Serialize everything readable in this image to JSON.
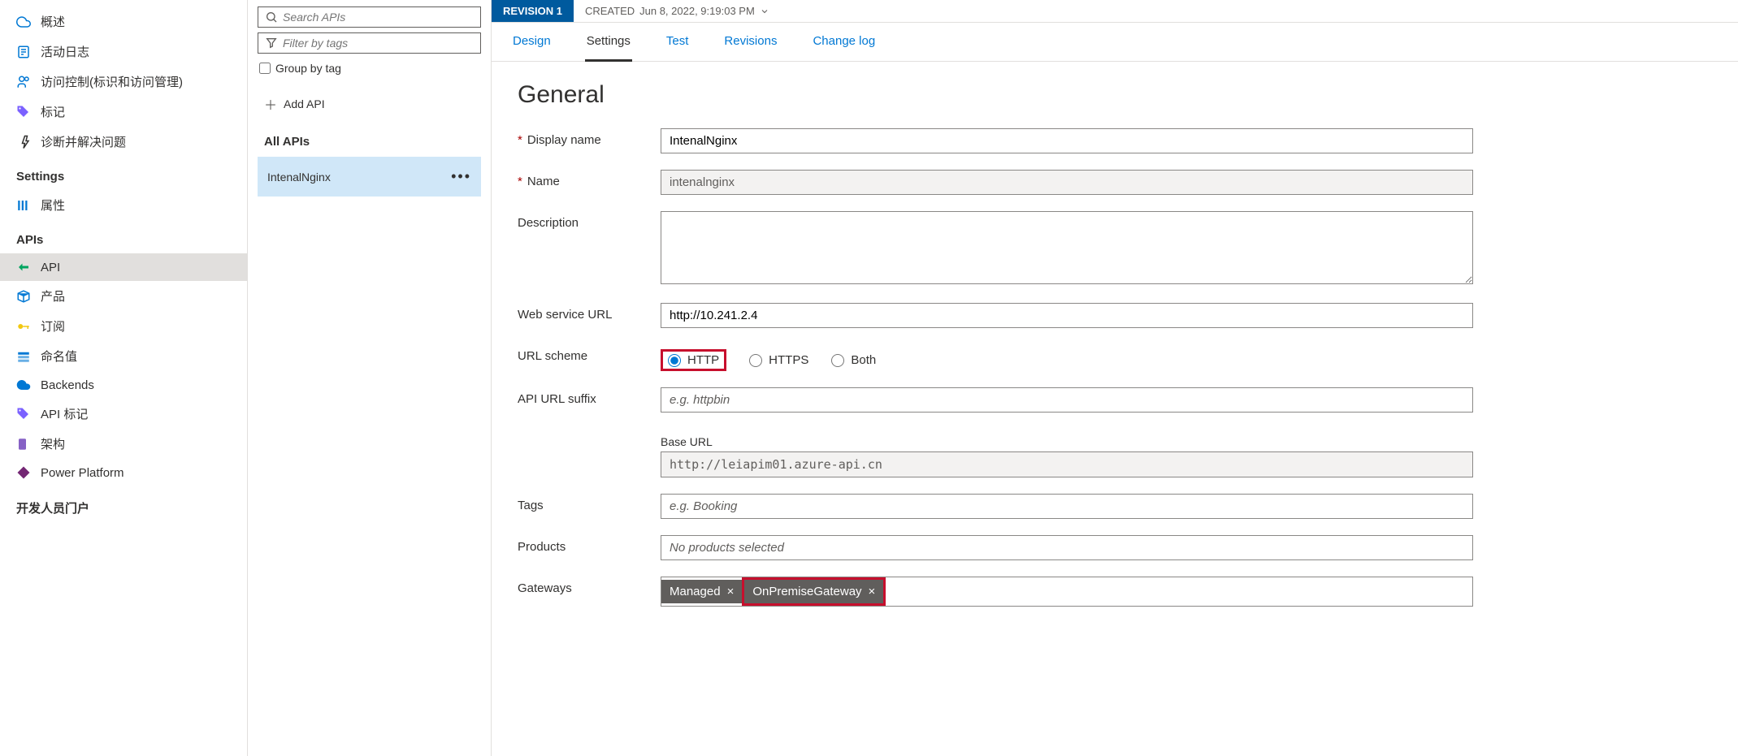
{
  "sidebar": {
    "overview": "概述",
    "activity_log": "活动日志",
    "access_control": "访问控制(标识和访问管理)",
    "tags": "标记",
    "diagnose": "诊断并解决问题",
    "settings_hdr": "Settings",
    "properties": "属性",
    "apis_hdr": "APIs",
    "api": "API",
    "products": "产品",
    "subscriptions": "订阅",
    "named_values": "命名值",
    "backends": "Backends",
    "api_tags": "API 标记",
    "schema": "架构",
    "power_platform": "Power Platform",
    "dev_portal": "开发人员门户"
  },
  "api_col": {
    "search_ph": "Search APIs",
    "filter_ph": "Filter by tags",
    "group_by": "Group by tag",
    "add_api": "Add API",
    "all_apis": "All APIs",
    "selected_api": "IntenalNginx"
  },
  "revision": {
    "badge": "REVISION 1",
    "created_label": "CREATED",
    "created_val": "Jun 8, 2022, 9:19:03 PM"
  },
  "tabs": {
    "design": "Design",
    "settings": "Settings",
    "test": "Test",
    "revisions": "Revisions",
    "changelog": "Change log"
  },
  "form": {
    "title": "General",
    "display_name_lbl": "Display name",
    "display_name_val": "IntenalNginx",
    "name_lbl": "Name",
    "name_val": "intenalnginx",
    "description_lbl": "Description",
    "web_url_lbl": "Web service URL",
    "web_url_val": "http://10.241.2.4",
    "url_scheme_lbl": "URL scheme",
    "scheme_http": "HTTP",
    "scheme_https": "HTTPS",
    "scheme_both": "Both",
    "suffix_lbl": "API URL suffix",
    "suffix_ph": "e.g. httpbin",
    "base_url_lbl": "Base URL",
    "base_url_val": "http://leiapim01.azure-api.cn",
    "tags_lbl": "Tags",
    "tags_ph": "e.g. Booking",
    "products_lbl": "Products",
    "products_ph": "No products selected",
    "gateways_lbl": "Gateways",
    "gw_managed": "Managed",
    "gw_onprem": "OnPremiseGateway"
  }
}
